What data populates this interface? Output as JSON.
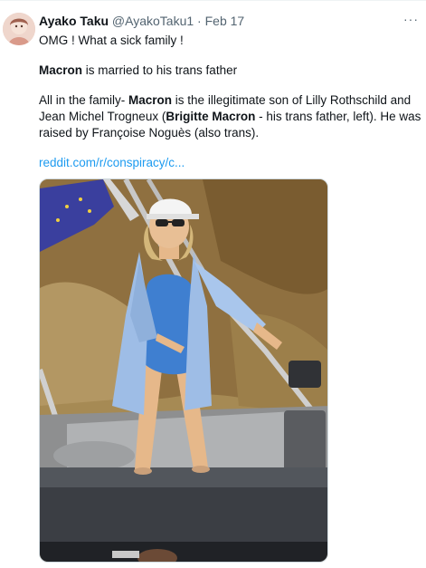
{
  "tweet": {
    "author_name": "Ayako Taku",
    "author_handle": "@AyakoTaku1",
    "separator": "·",
    "date": "Feb 17",
    "more_label": "···",
    "line1": "OMG ! What a sick family !",
    "p2": {
      "bold": "Macron",
      "rest": " is married to his trans father"
    },
    "p3": {
      "a": "All in the family- ",
      "b": "Macron",
      "c": " is the illegitimate son of Lilly Rothschild and Jean Michel Trogneux (",
      "d": "Brigitte Macron",
      "e": " - his trans father, left). He was raised by Françoise Noguès (also trans)."
    },
    "link_text": "reddit.com/r/conspiracy/c..."
  },
  "colors": {
    "link": "#1d9bf0",
    "muted": "#536471",
    "text": "#0f1419"
  },
  "icons": {
    "more": "more-horizontal-icon"
  }
}
